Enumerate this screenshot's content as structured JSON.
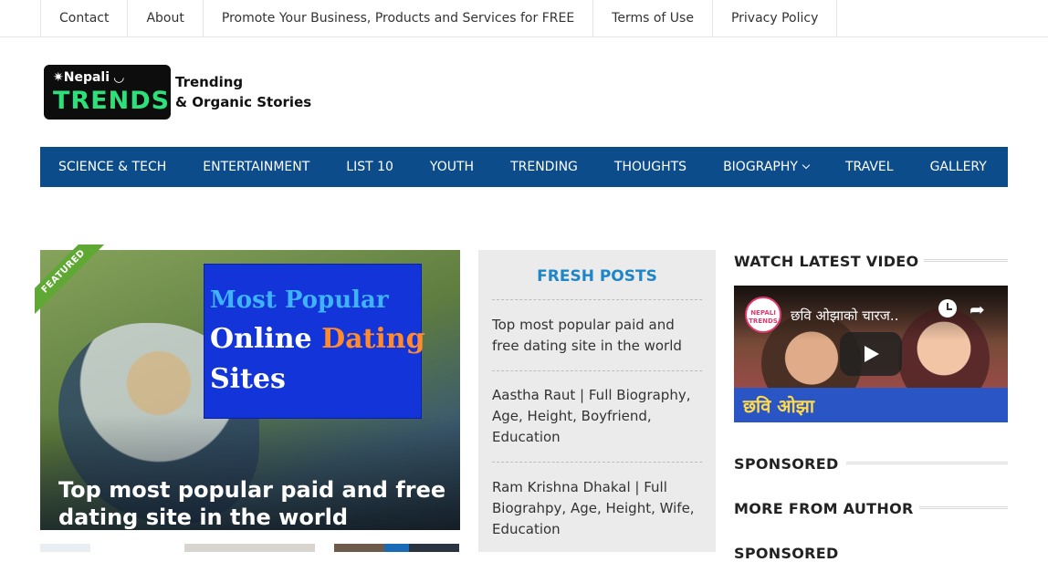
{
  "topnav": {
    "items": [
      "Contact",
      "About",
      "Promote Your Business, Products and Services for FREE",
      "Terms of Use",
      "Privacy Policy"
    ]
  },
  "logo": {
    "brand_top": "Nepali",
    "brand_main": "TRENDS",
    "tagline_1": "Trending",
    "tagline_2": "& Organic Stories"
  },
  "mainnav": {
    "items": [
      "SCIENCE & TECH",
      "ENTERTAINMENT",
      "LIST 10",
      "YOUTH",
      "TRENDING",
      "THOUGHTS",
      "BIOGRAPHY",
      "TRAVEL",
      "GALLERY"
    ],
    "bg_color": "#0c4c8a"
  },
  "featured": {
    "badge": "FEATURED",
    "image_line1": "Most Popular",
    "image_line2a": "Online ",
    "image_line2b": "Dating",
    "image_line3": "Sites",
    "title": "Top most popular paid and free dating site in the world"
  },
  "fresh_posts": {
    "heading": "FRESH POSTS",
    "items": [
      "Top most popular paid and free dating site in the world",
      "Aastha Raut | Full Biography, Age, Height, Boyfriend, Education",
      "Ram Krishna Dhakal | Full Biograhpy, Age, Height, Wife, Education"
    ],
    "accent": "#1e86c8"
  },
  "sidebar": {
    "watch_heading": "WATCH LATEST VIDEO",
    "video": {
      "channel": "NEPALI TRENDS",
      "title": "छवि ओझाको चारज..",
      "overlay_text": "छवि ओझा"
    },
    "sponsored_heading": "SPONSORED",
    "more_heading": "MORE FROM AUTHOR",
    "sponsored_heading_2": "SPONSORED"
  }
}
